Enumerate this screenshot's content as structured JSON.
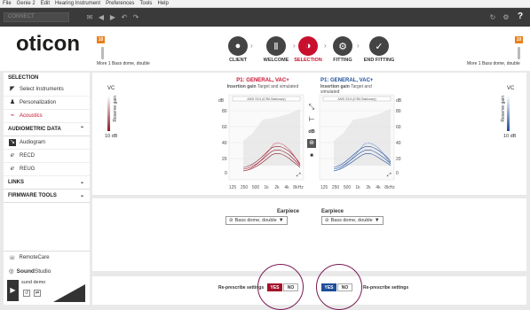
{
  "menu": [
    "File",
    "Genie 2",
    "Edit",
    "Hearing Instrument",
    "Preferences",
    "Tools",
    "Help"
  ],
  "toolbar": {
    "client_field": "CONNECT",
    "right_icons": [
      "refresh-icon",
      "settings-icon",
      "help-icon"
    ]
  },
  "header": {
    "logo": "oticon",
    "left_hi": {
      "badge": "10",
      "label": "More 1 Bass dome, double"
    },
    "right_hi": {
      "badge": "10",
      "label": "More 1 Bass dome, double"
    },
    "steps": [
      {
        "label": "CLIENT",
        "icon": "person-icon"
      },
      {
        "label": "WELCOME",
        "icon": "devices-icon"
      },
      {
        "label": "SELECTION",
        "icon": "selection-icon"
      },
      {
        "label": "FITTING",
        "icon": "fitting-icon"
      },
      {
        "label": "END FITTING",
        "icon": "check-icon"
      }
    ]
  },
  "sidebar": {
    "selection_title": "SELECTION",
    "selection_items": [
      "Select Instruments",
      "Personalization",
      "Acoustics"
    ],
    "audiometric_title": "AUDIOMETRIC DATA",
    "audiometric_items": [
      "Audiogram",
      "RECD",
      "REUG"
    ],
    "links_title": "LINKS",
    "firmware_title": "FIRMWARE TOOLS",
    "remotecare": "RemoteCare",
    "soundstudio_bold": "Sound",
    "soundstudio_rest": "Studio",
    "sound_demo": "sund demo"
  },
  "graphs": {
    "left": {
      "title": "P1: GENERAL, VAC+",
      "sub1": "Insertion gain",
      "sub2": "Target and simulated",
      "legend": "ANSI S3.6 (ICRA Stationary)",
      "color": "#8b1a2b"
    },
    "right": {
      "title": "P1: GENERAL, VAC+",
      "sub1": "Insertion gain",
      "sub2": "Target and simulated",
      "legend": "ANSI S3.6 (ICRA Stationary)",
      "color": "#1f4e9a"
    },
    "y_unit": "dB",
    "y_ticks": [
      "80",
      "60",
      "40",
      "20",
      "0"
    ],
    "x_ticks": [
      "125",
      "250",
      "500",
      "1k",
      "2k",
      "4k",
      "8kHz"
    ],
    "reserve_label": "Reserve gain",
    "vc_label": "VC",
    "reserve_value": "10 dB",
    "tool_icons": [
      "curve-icon",
      "flat-icon",
      "db-icon",
      "ear-icon",
      "stop-icon"
    ]
  },
  "earpiece": {
    "label": "Earpiece",
    "left_value": "Bass dome, double",
    "right_value": "Bass dome, double"
  },
  "represcribe": {
    "label": "Re-prescribe settings",
    "yes": "YES",
    "no": "NO",
    "left_color": "#a3132c",
    "right_color": "#1f4e9a"
  }
}
